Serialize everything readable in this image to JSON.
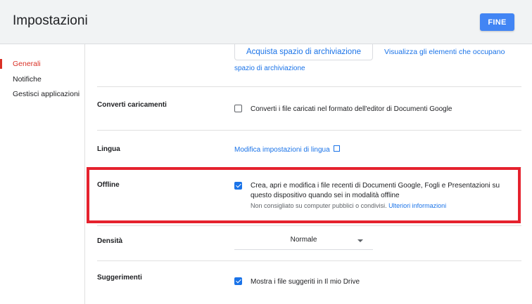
{
  "window": {
    "title": "Impostazioni",
    "done_label": "FINE"
  },
  "sidebar": {
    "items": [
      {
        "label": "Generali"
      },
      {
        "label": "Notifiche"
      },
      {
        "label": "Gestisci applicazioni"
      }
    ]
  },
  "storage": {
    "buy_label": "Acquista spazio di archiviazione",
    "view_link_part1": "Visualizza gli elementi che occupano",
    "view_link_part2": "spazio di archiviazione"
  },
  "convert": {
    "label": "Converti caricamenti",
    "option": "Converti i file caricati nel formato dell'editor di Documenti Google",
    "checked": false
  },
  "language": {
    "label": "Lingua",
    "link": "Modifica impostazioni di lingua"
  },
  "offline": {
    "label": "Offline",
    "line1": "Crea, apri e modifica i file recenti di Documenti Google, Fogli e Presentazioni su",
    "line2": "questo dispositivo quando sei in modalità offline",
    "note": "Non consigliato su computer pubblici o condivisi.",
    "more_link": "Ulteriori informazioni",
    "checked": true,
    "highlight_color": "#e5222e"
  },
  "density": {
    "label": "Densità",
    "value": "Normale"
  },
  "suggestions": {
    "label": "Suggerimenti",
    "option": "Mostra i file suggeriti in Il mio Drive",
    "checked": true
  },
  "colors": {
    "accent": "#4285f4",
    "link": "#1a73e8",
    "active_nav": "#d93025"
  }
}
